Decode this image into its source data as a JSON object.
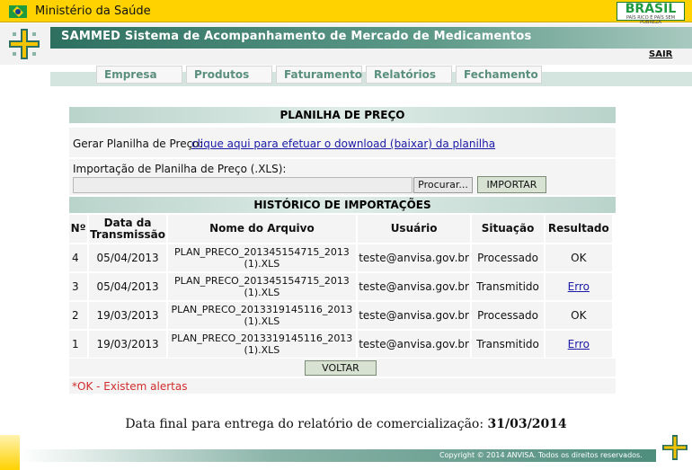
{
  "gov_bar": {
    "title": "Ministério da Saúde",
    "brasil_logo": "BRASIL",
    "brasil_tagline": "PAÍS RICO É PAÍS SEM POBREZA"
  },
  "app": {
    "title": "SAMMED Sistema de Acompanhamento de Mercado de Medicamentos",
    "logout": "SAIR"
  },
  "nav": [
    "Empresa",
    "Produtos",
    "Faturamento",
    "Relatórios",
    "Fechamento"
  ],
  "planilha": {
    "header": "PLANILHA DE PREÇO",
    "gerar_label": "Gerar Planilha de Preço:",
    "gerar_link": "clique aqui para efetuar o download (baixar) da planilha",
    "import_label": "Importação de Planilha de Preço (.XLS):",
    "file_value": "",
    "browse_button": "Procurar...",
    "import_button": "IMPORTAR"
  },
  "historico": {
    "header": "HISTÓRICO DE IMPORTAÇÕES",
    "columns": [
      "Nº",
      "Data da Transmissão",
      "Nome do Arquivo",
      "Usuário",
      "Situação",
      "Resultado"
    ],
    "rows": [
      {
        "num": "4",
        "date": "05/04/2013",
        "file": "PLAN_PRECO_201345154715_2013 (1).XLS",
        "user": "teste@anvisa.gov.br",
        "status": "Processado",
        "result": "OK",
        "result_link": false
      },
      {
        "num": "3",
        "date": "05/04/2013",
        "file": "PLAN_PRECO_201345154715_2013 (1).XLS",
        "user": "teste@anvisa.gov.br",
        "status": "Transmitido",
        "result": "Erro",
        "result_link": true
      },
      {
        "num": "2",
        "date": "19/03/2013",
        "file": "PLAN_PRECO_2013319145116_2013 (1).XLS",
        "user": "teste@anvisa.gov.br",
        "status": "Processado",
        "result": "OK",
        "result_link": false
      },
      {
        "num": "1",
        "date": "19/03/2013",
        "file": "PLAN_PRECO_2013319145116_2013 (1).XLS",
        "user": "teste@anvisa.gov.br",
        "status": "Transmitido",
        "result": "Erro",
        "result_link": true
      }
    ],
    "back_button": "VOLTAR",
    "alert_note": "*OK - Existem alertas"
  },
  "deadline": {
    "label": "Data final para entrega do relatório de comercialização:",
    "date": "31/03/2014"
  },
  "footer": {
    "copyright": "Copyright © 2014 ANVISA. Todos os direitos reservados."
  },
  "colors": {
    "gov_yellow": "#ffd200",
    "header_teal": "#2e7060",
    "nav_text": "#5a8f7d",
    "alert_red": "#d12d2d",
    "link_blue": "#1a1aa6"
  },
  "icons": {
    "app_logo": "health-cross-icon",
    "flag": "brazil-flag-icon"
  }
}
